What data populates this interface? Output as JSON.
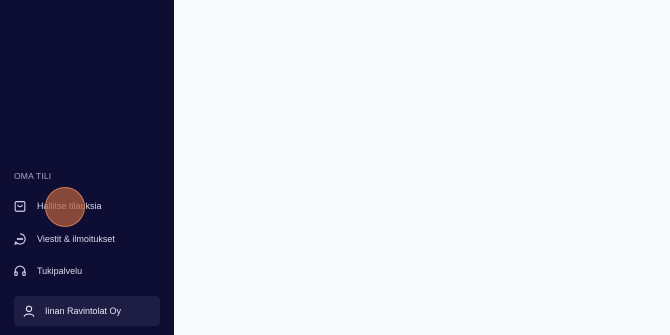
{
  "sidebar": {
    "section_label": "OMA TILI",
    "items": [
      {
        "label": "Hallitse tilauksia",
        "icon": "shopping-bag-icon"
      },
      {
        "label": "Viestit & ilmoitukset",
        "icon": "chat-bubble-icon"
      },
      {
        "label": "Tukipalvelu",
        "icon": "headphones-icon"
      }
    ],
    "account": {
      "name": "Iinan Ravintolat Oy",
      "icon": "user-icon"
    }
  },
  "colors": {
    "sidebar_bg": "#0e0d33",
    "main_bg": "#f9fafd",
    "account_card_bg": "#1e1d44",
    "click_marker": "#b5603f"
  }
}
